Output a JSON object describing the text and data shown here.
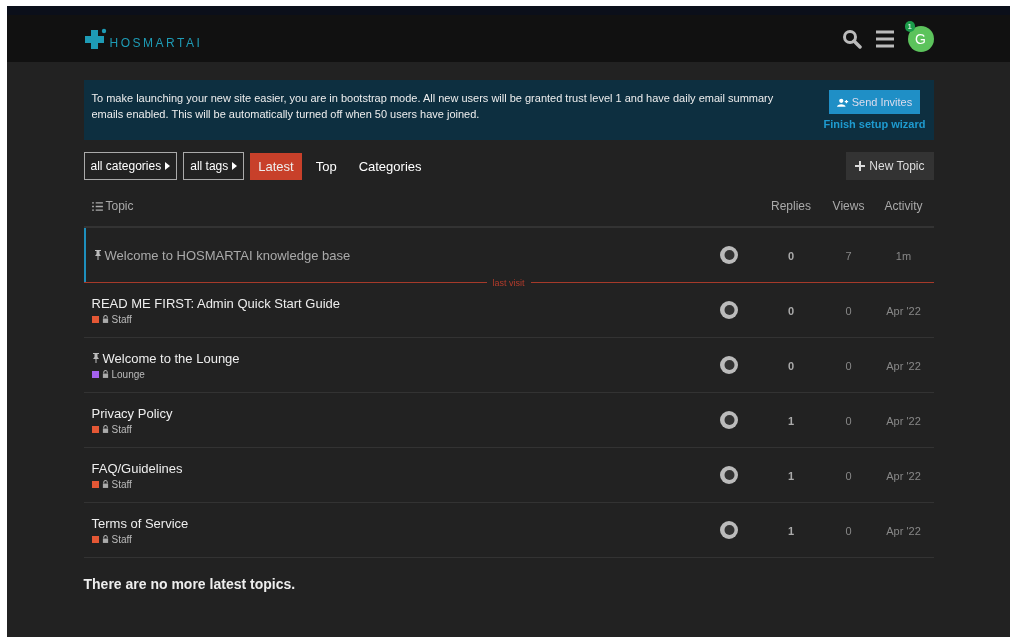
{
  "header": {
    "logo_text": "HOSMARTAI",
    "avatar_letter": "G",
    "notification_count": "1"
  },
  "banner": {
    "text": "To make launching your new site easier, you are in bootstrap mode. All new users will be granted trust level 1 and have daily email summary emails enabled. This will be automatically turned off when 50 users have joined.",
    "button": "Send Invites",
    "link": "Finish setup wizard"
  },
  "filters": [
    {
      "label": "all categories"
    },
    {
      "label": "all tags"
    }
  ],
  "tabs": [
    {
      "label": "Latest",
      "selected": true
    },
    {
      "label": "Top",
      "selected": false
    },
    {
      "label": "Categories",
      "selected": false
    }
  ],
  "new_topic_button": "New Topic",
  "columns": [
    "Topic",
    "Replies",
    "Views",
    "Activity"
  ],
  "topics": [
    {
      "kind": "topic",
      "title": "Welcome to HOSMARTAI knowledge base",
      "pinned": true,
      "visited": true,
      "highlighted": true,
      "replies": "0",
      "views": "7",
      "activity": "1m"
    },
    {
      "kind": "divider",
      "label": "last visit"
    },
    {
      "kind": "topic",
      "title": "READ ME FIRST: Admin Quick Start Guide",
      "pinned": false,
      "visited": false,
      "highlighted": false,
      "category": "Staff",
      "color": "#e45735",
      "replies": "0",
      "views": "0",
      "activity": "Apr '22"
    },
    {
      "kind": "topic",
      "title": "Welcome to the Lounge",
      "pinned": true,
      "visited": false,
      "highlighted": false,
      "category": "Lounge",
      "color": "#a461ef",
      "replies": "0",
      "views": "0",
      "activity": "Apr '22"
    },
    {
      "kind": "topic",
      "title": "Privacy Policy",
      "pinned": false,
      "visited": false,
      "highlighted": false,
      "category": "Staff",
      "color": "#e45735",
      "replies": "1",
      "views": "0",
      "activity": "Apr '22"
    },
    {
      "kind": "topic",
      "title": "FAQ/Guidelines",
      "pinned": false,
      "visited": false,
      "highlighted": false,
      "category": "Staff",
      "color": "#e45735",
      "replies": "1",
      "views": "0",
      "activity": "Apr '22"
    },
    {
      "kind": "topic",
      "title": "Terms of Service",
      "pinned": false,
      "visited": false,
      "highlighted": false,
      "category": "Staff",
      "color": "#e45735",
      "replies": "1",
      "views": "0",
      "activity": "Apr '22"
    }
  ],
  "footer_message": "There are no more latest topics."
}
